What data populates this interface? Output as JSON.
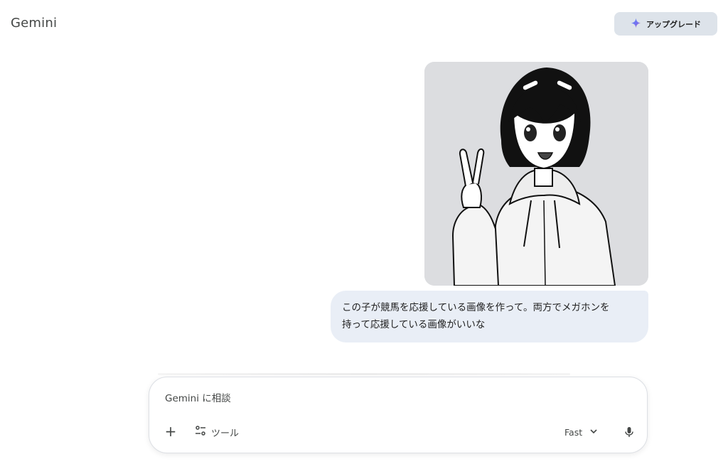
{
  "header": {
    "app_title": "Gemini",
    "upgrade_label": "アップグレード",
    "upgrade_icon": "sparkle-icon"
  },
  "conversation": {
    "image": {
      "icon": "generated-image",
      "alt": "user uploaded image"
    },
    "user_message": {
      "line1": "この子が競馬を応援している画像を作って。両方でメガホンを",
      "line2": "持って応援している画像がいいな"
    }
  },
  "composer": {
    "placeholder": "Gemini に相談",
    "value": "",
    "add_icon": "plus-icon",
    "tools_label": "ツール",
    "tools_icon": "tune-icon",
    "model_label": "Fast",
    "model_icon": "chevron-down-icon",
    "mic_icon": "microphone-icon"
  },
  "colors": {
    "background": "#ffffff",
    "user_bubble": "#e9eef6",
    "upgrade_button": "#dde3ea",
    "image_background": "#dcdde0",
    "text_secondary": "#444746"
  }
}
